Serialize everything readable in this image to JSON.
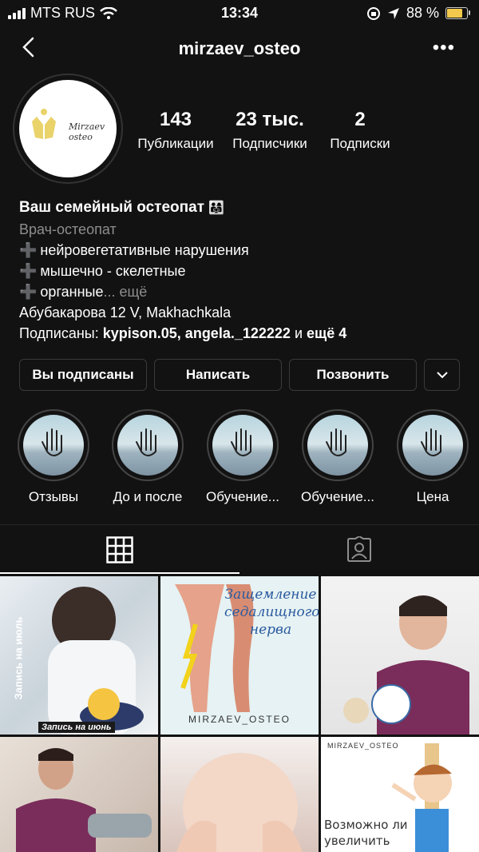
{
  "status_bar": {
    "carrier": "MTS RUS",
    "time": "13:34",
    "battery": "88 %",
    "battery_level": 0.88
  },
  "header": {
    "username": "mirzaev_osteo"
  },
  "profile": {
    "logo_text": "Mirzaev osteo",
    "stats": [
      {
        "value": "143",
        "label": "Публикации"
      },
      {
        "value": "23 тыс.",
        "label": "Подписчики"
      },
      {
        "value": "2",
        "label": "Подписки"
      }
    ],
    "name": "Ваш семейный остеопат",
    "category": "Врач-остеопат",
    "bio_lines": [
      "нейровегетативные нарушения",
      "мышечно - скелетные",
      "органные"
    ],
    "more_label": "... ещё",
    "address": "Абубакарова 12 V, Makhachkala",
    "followed_by_prefix": "Подписаны:",
    "followed_by_names": "kypison.05, angela._122222",
    "followed_by_and": "и",
    "followed_by_more": "ещё 4"
  },
  "actions": {
    "following": "Вы подписаны",
    "message": "Написать",
    "call": "Позвонить"
  },
  "highlights": [
    {
      "label": "Отзывы"
    },
    {
      "label": "До и после"
    },
    {
      "label": "Обучение..."
    },
    {
      "label": "Обучение..."
    },
    {
      "label": "Цена"
    }
  ],
  "tabs": [
    "grid-icon",
    "tagged-icon"
  ],
  "posts": {
    "post1_vertical": "Запись на июль",
    "post1_caption": "Запись на июнь",
    "post2_title_line1": "Защемление",
    "post2_title_line2": "седалищного",
    "post2_title_line3": "нерва",
    "post2_brand": "MIRZAEV_OSTEO",
    "post6_brand": "MIRZAEV_OSTEO",
    "post6_line1": "Возможно ли",
    "post6_line2": "увеличить"
  },
  "colors": {
    "background": "#121212",
    "muted": "#8e8e8e",
    "button_border": "#3a3a3a",
    "battery": "#f2c94c"
  }
}
